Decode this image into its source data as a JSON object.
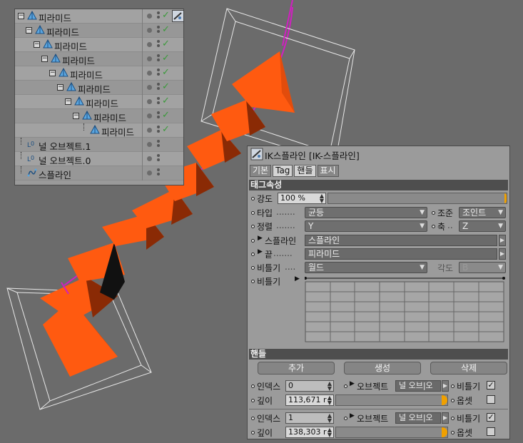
{
  "object_manager": {
    "rows": [
      {
        "name": "피라미드",
        "indent": 0,
        "type": "pyramid",
        "check": true,
        "tag": true
      },
      {
        "name": "피라미드",
        "indent": 1,
        "type": "pyramid",
        "check": true,
        "tag": false
      },
      {
        "name": "피라미드",
        "indent": 2,
        "type": "pyramid",
        "check": true,
        "tag": false
      },
      {
        "name": "피라미드",
        "indent": 3,
        "type": "pyramid",
        "check": true,
        "tag": false
      },
      {
        "name": "피라미드",
        "indent": 4,
        "type": "pyramid",
        "check": true,
        "tag": false
      },
      {
        "name": "피라미드",
        "indent": 5,
        "type": "pyramid",
        "check": true,
        "tag": false
      },
      {
        "name": "피라미드",
        "indent": 6,
        "type": "pyramid",
        "check": true,
        "tag": false
      },
      {
        "name": "피라미드",
        "indent": 7,
        "type": "pyramid",
        "check": true,
        "tag": false
      },
      {
        "name": "피라미드",
        "indent": 8,
        "type": "pyramid",
        "check": true,
        "tag": false
      },
      {
        "name": "널 오브젝트.1",
        "indent": 0,
        "type": "null",
        "check": false,
        "tag": false
      },
      {
        "name": "널 오브젝트.0",
        "indent": 0,
        "type": "null",
        "check": false,
        "tag": false
      },
      {
        "name": "스플라인",
        "indent": 0,
        "type": "spline",
        "check": false,
        "tag": false
      }
    ]
  },
  "attr": {
    "title": "IK스플라인 [IK-스플라인]",
    "tabs": [
      "기본",
      "Tag",
      "핸들",
      "표시"
    ],
    "section_tag": "태그속성",
    "strength_label": "강도",
    "strength_value": "100 %",
    "type_label": "타입",
    "type_value": "균등",
    "goal_label": "조준",
    "goal_value": "조인트",
    "align_label": "정렬",
    "align_value": "Y",
    "axis_label": "축",
    "axis_value": "Z",
    "spline_label": "스플라인",
    "spline_value": "스플라인",
    "tip_label": "끝",
    "tip_value": "피라미드",
    "twist_label": "비틀기",
    "twist_value": "월드",
    "angle_label": "각도",
    "angle_value": "B",
    "twist_graph_label": "비틀기",
    "section_handles": "핸들",
    "add_label": "추가",
    "create_label": "생성",
    "delete_label": "삭제",
    "handles": [
      {
        "index_label": "인덱스",
        "index_value": "0",
        "object_label": "오브젝트",
        "object_value": "널 오브|오",
        "twist_label": "비틀기",
        "depth_label": "깊이",
        "depth_value": "113,671 r",
        "offset_label": "옵셋",
        "twist_checked": true
      },
      {
        "index_label": "인덱스",
        "index_value": "1",
        "object_label": "오브젝트",
        "object_value": "널 오브|오",
        "twist_label": "비틀기",
        "depth_label": "깊이",
        "depth_value": "138,303 r",
        "offset_label": "옵셋",
        "twist_checked": true
      }
    ]
  },
  "colors": {
    "viewport_bg": "#6b6b6b",
    "pyramid": "#ff5a10",
    "pyramid_dark": "#8a2a05",
    "panel_bg": "#9b9b9b",
    "section_bg": "#4e4e4e",
    "check": "#3a9a3a",
    "slider_knob": "#f0a000"
  }
}
